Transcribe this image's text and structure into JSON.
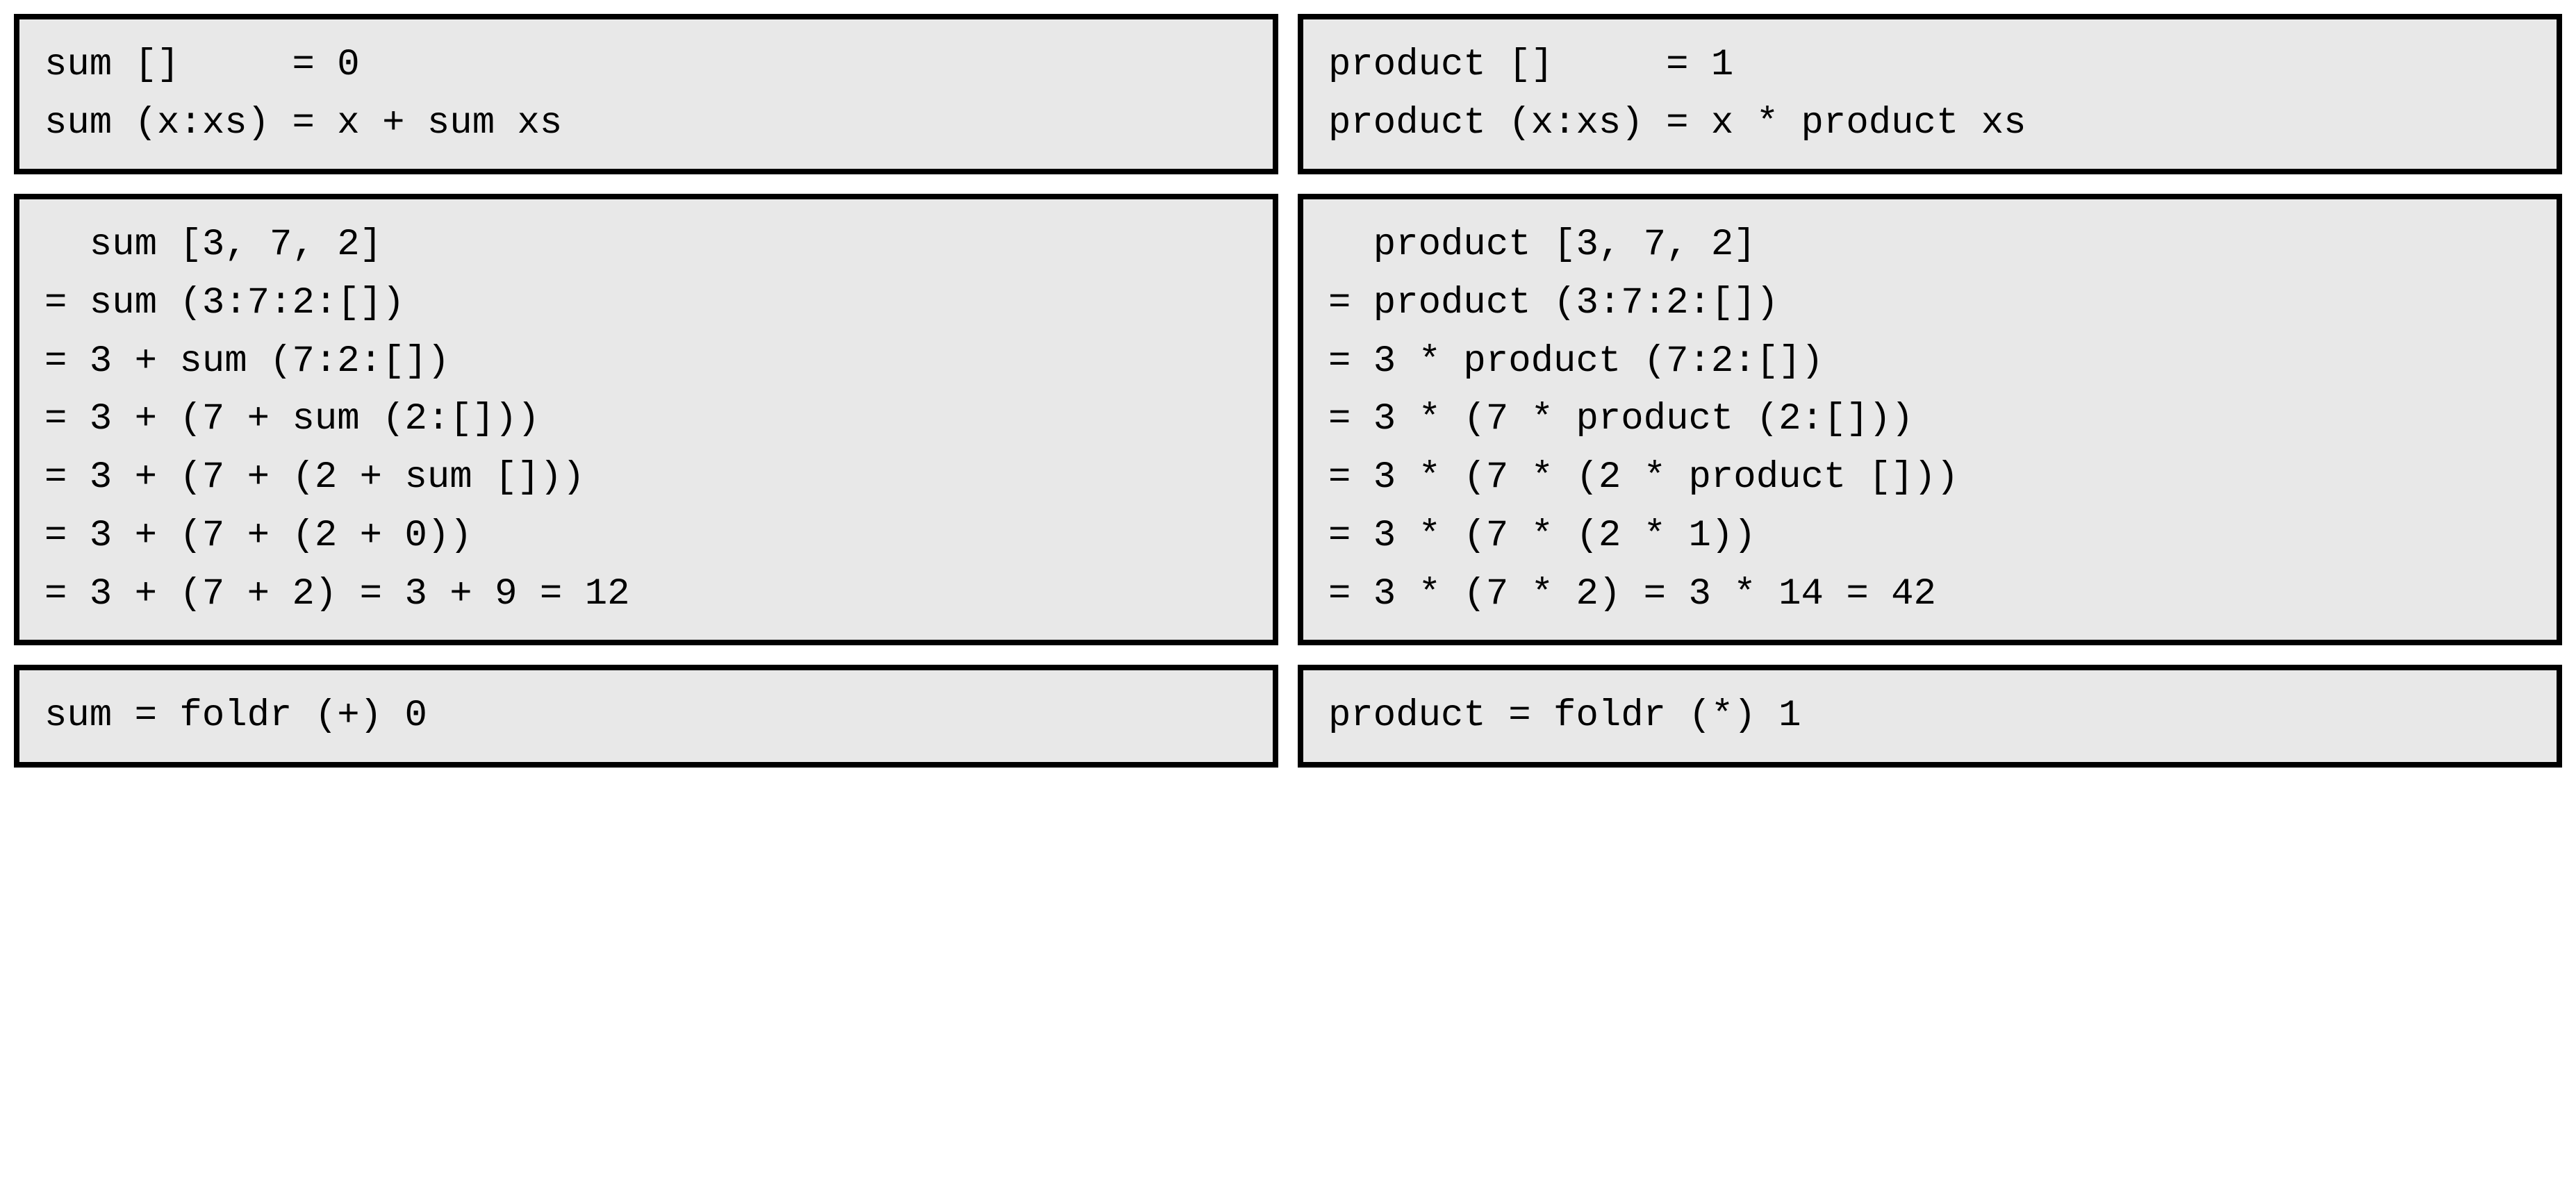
{
  "left": {
    "definition": "sum []     = 0\nsum (x:xs) = x + sum xs",
    "evaluation": "  sum [3, 7, 2]\n= sum (3:7:2:[])\n= 3 + sum (7:2:[])\n= 3 + (7 + sum (2:[]))\n= 3 + (7 + (2 + sum []))\n= 3 + (7 + (2 + 0))\n= 3 + (7 + 2) = 3 + 9 = 12",
    "fold": "sum = foldr (+) 0"
  },
  "right": {
    "definition": "product []     = 1\nproduct (x:xs) = x * product xs",
    "evaluation": "  product [3, 7, 2]\n= product (3:7:2:[])\n= 3 * product (7:2:[])\n= 3 * (7 * product (2:[]))\n= 3 * (7 * (2 * product []))\n= 3 * (7 * (2 * 1))\n= 3 * (7 * 2) = 3 * 14 = 42",
    "fold": "product = foldr (*) 1"
  }
}
